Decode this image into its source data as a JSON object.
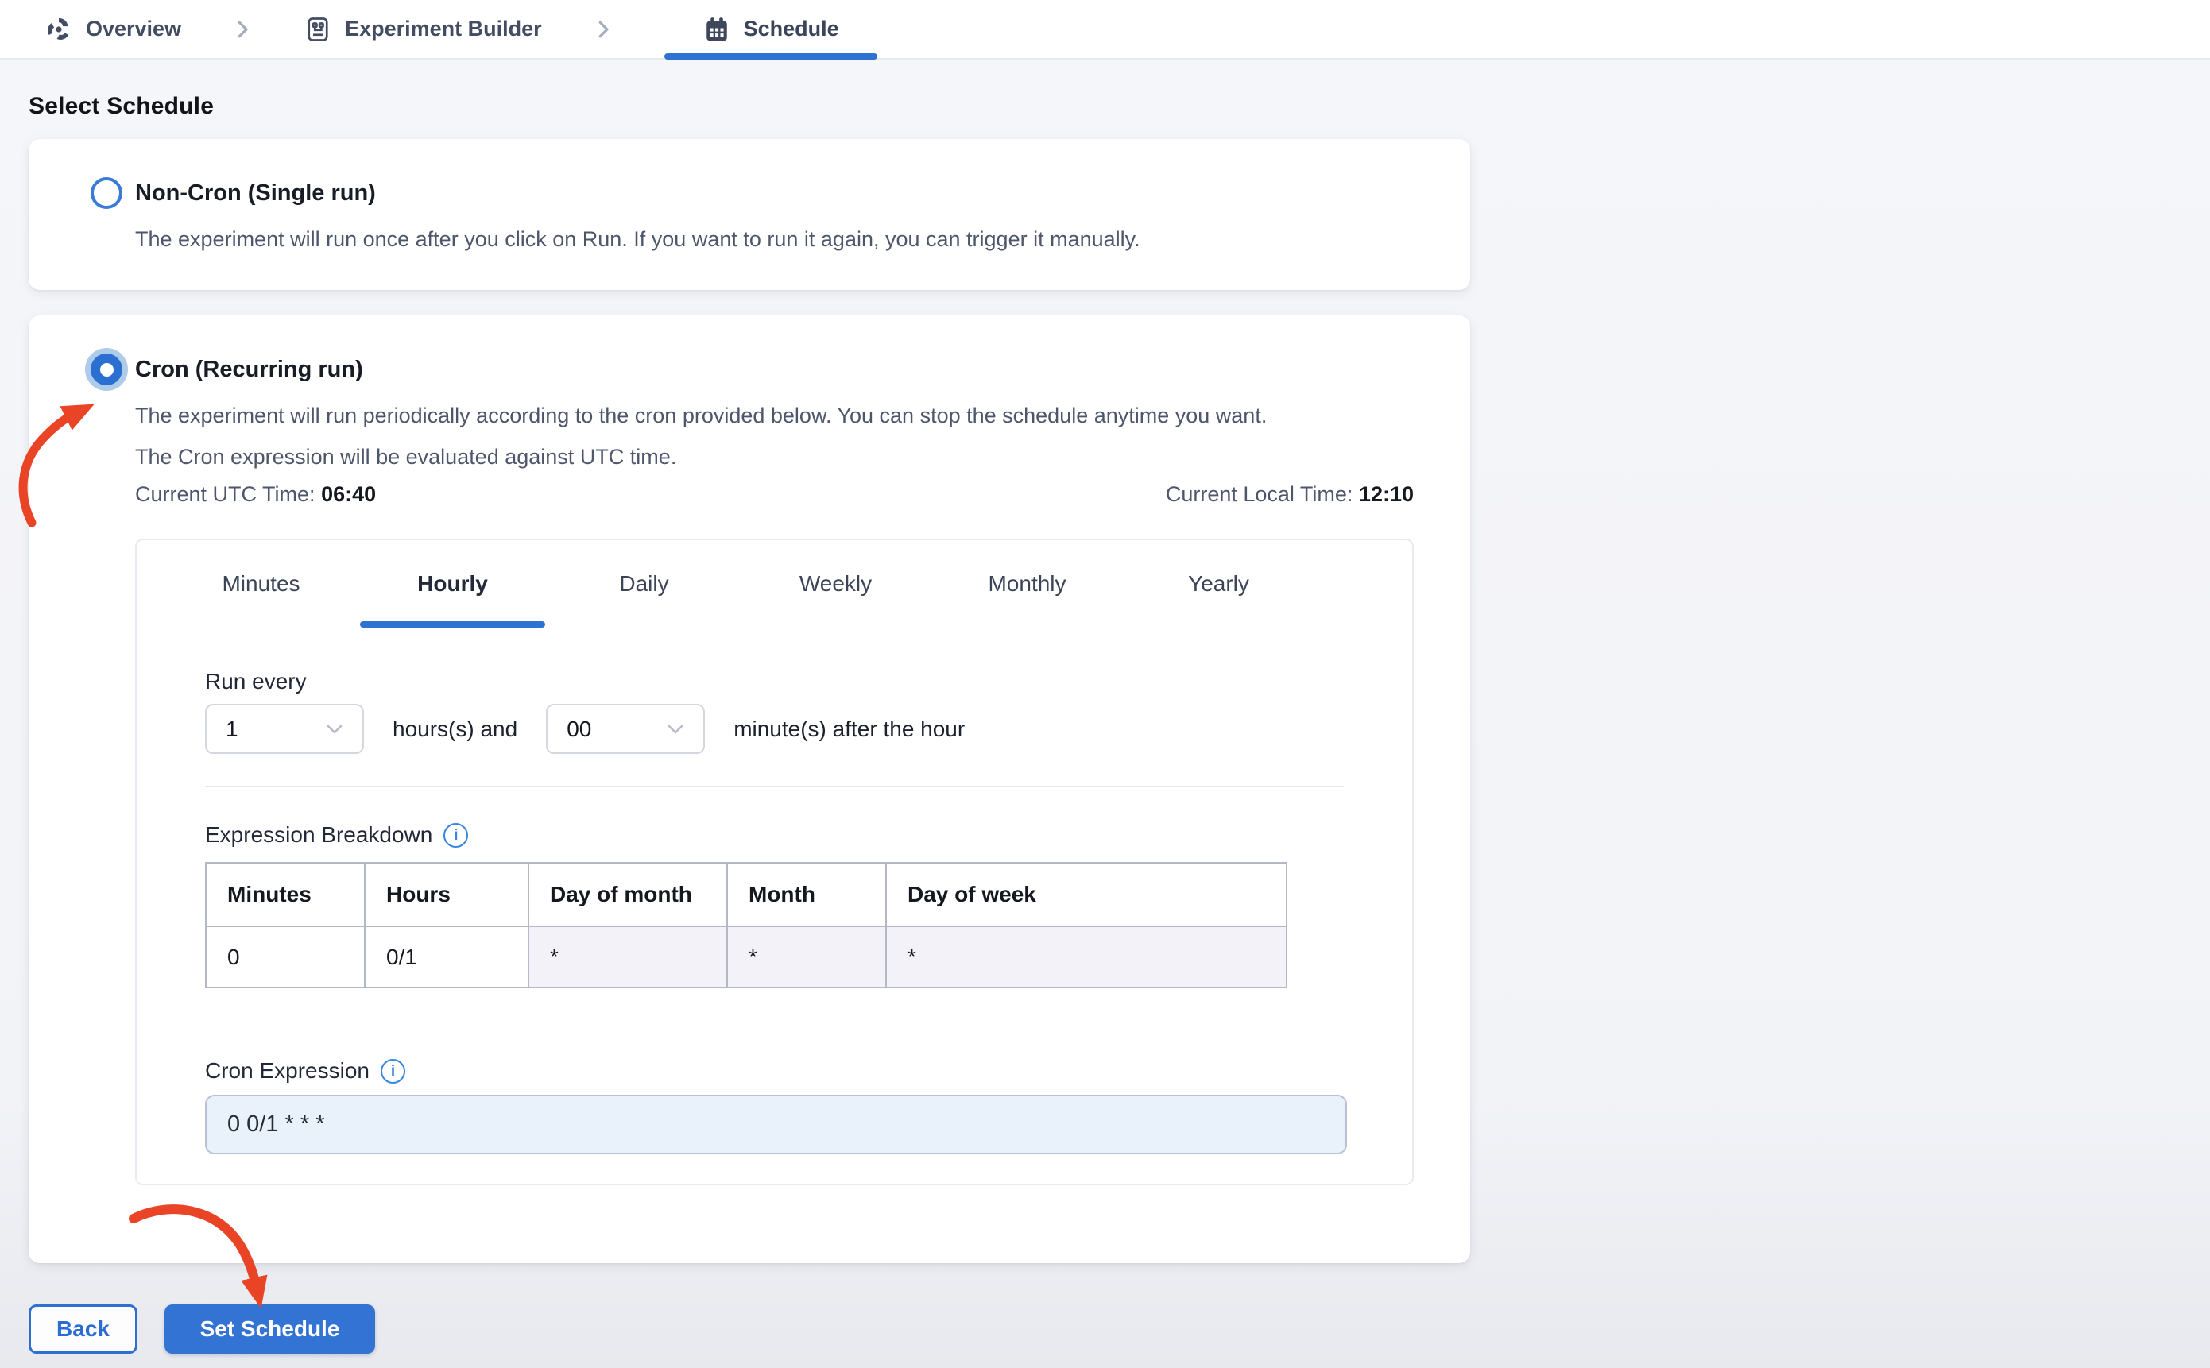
{
  "breadcrumb": {
    "items": [
      {
        "label": "Overview",
        "icon": "overview-icon"
      },
      {
        "label": "Experiment Builder",
        "icon": "experiment-builder-icon"
      },
      {
        "label": "Schedule",
        "icon": "calendar-icon",
        "active": true
      }
    ]
  },
  "page": {
    "title": "Select Schedule"
  },
  "options": {
    "non_cron": {
      "title": "Non-Cron (Single run)",
      "description": "The experiment will run once after you click on Run. If you want to run it again, you can trigger it manually.",
      "selected": false
    },
    "cron": {
      "title": "Cron (Recurring run)",
      "description_line1": "The experiment will run periodically according to the cron provided below. You can stop the schedule anytime you want.",
      "description_line2": "The Cron expression will be evaluated against UTC time.",
      "utc_time_label": "Current UTC Time:",
      "utc_time_value": "06:40",
      "local_time_label": "Current Local Time:",
      "local_time_value": "12:10",
      "selected": true
    }
  },
  "scheduler": {
    "tabs": [
      {
        "label": "Minutes",
        "active": false
      },
      {
        "label": "Hourly",
        "active": true
      },
      {
        "label": "Daily",
        "active": false
      },
      {
        "label": "Weekly",
        "active": false
      },
      {
        "label": "Monthly",
        "active": false
      },
      {
        "label": "Yearly",
        "active": false
      }
    ],
    "run_every_label": "Run every",
    "hours_select_value": "1",
    "hours_suffix": "hours(s) and",
    "minutes_select_value": "00",
    "minutes_suffix": "minute(s) after the hour",
    "expression_breakdown": {
      "label": "Expression Breakdown",
      "columns": [
        "Minutes",
        "Hours",
        "Day of month",
        "Month",
        "Day of week"
      ],
      "values": [
        "0",
        "0/1",
        "*",
        "*",
        "*"
      ]
    },
    "cron_expression": {
      "label": "Cron Expression",
      "value": "0 0/1 * * *"
    }
  },
  "actions": {
    "back_label": "Back",
    "set_schedule_label": "Set Schedule"
  },
  "icons": {
    "info_glyph": "i"
  },
  "colors": {
    "accent_blue": "#2e72d2",
    "arrow_red": "#ea4426",
    "radio_halo": "#aecbe9",
    "star_cell_bg": "#f2f2f8",
    "cron_input_bg": "#e9f1fb",
    "page_bg": "#f3f4f7"
  }
}
